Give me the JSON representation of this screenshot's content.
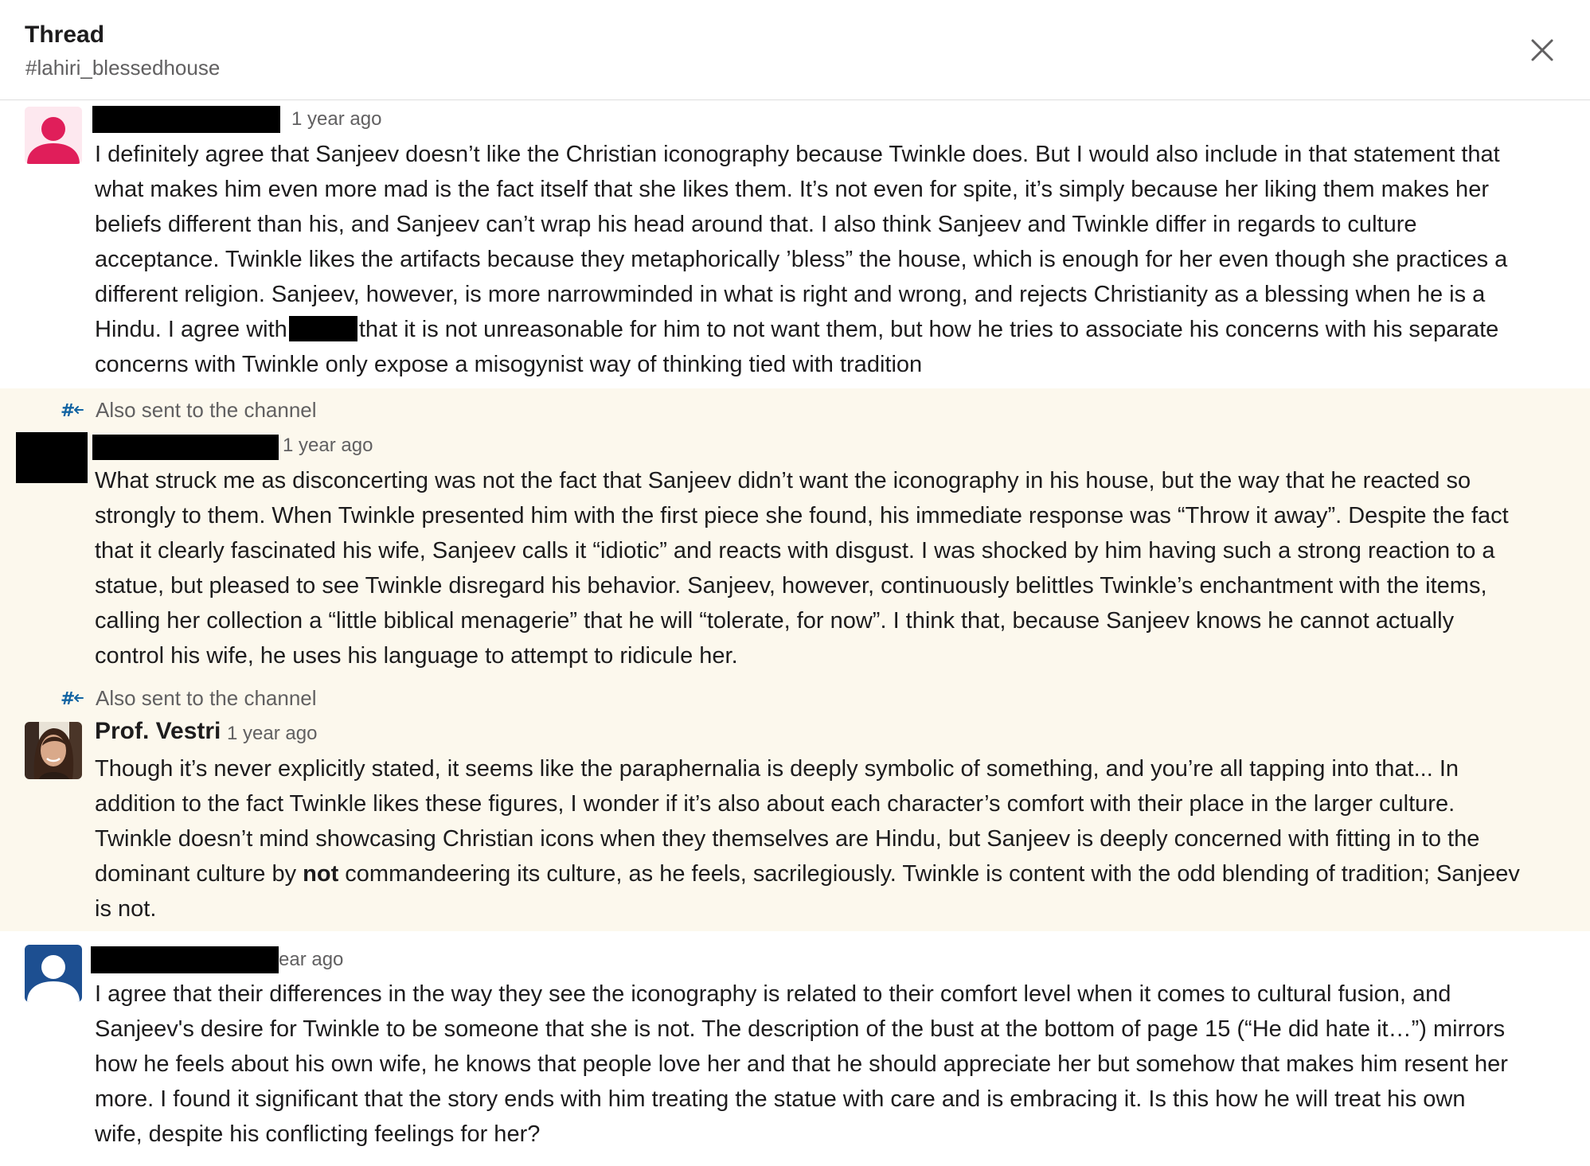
{
  "header": {
    "title": "Thread",
    "channel": "#lahiri_blessedhouse"
  },
  "messages": [
    {
      "time": "1 year ago",
      "author_redacted": true,
      "lines": [
        "I definitely agree that Sanjeev doesn’t like the Christian iconography because Twinkle does. But I would also include in that statement that",
        "what makes him even more mad is the fact itself that she likes them. It’s not even for spite, it’s simply because her liking them makes her",
        "beliefs different than his, and Sanjeev can’t wrap his head around that. I also think Sanjeev and Twinkle differ in regards to culture",
        "acceptance. Twinkle likes the artifacts because they metaphorically ’bless” the house, which is enough for her even though she practices a",
        "different religion. Sanjeev, however, is more narrowminded in what is right and wrong, and rejects Christianity as a blessing when he is a"
      ],
      "line6_before": "Hindu. I agree with",
      "line6_after": "that it is not unreasonable for him to not want them, but how he tries to associate his concerns with his separate",
      "line7": "concerns with Twinkle only expose a misogynist way of thinking tied with tradition"
    },
    {
      "also_sent": "Also sent to the channel",
      "time": "1 year ago",
      "author_redacted": true,
      "lines": [
        "What struck me as disconcerting was not the fact that Sanjeev didn’t want the iconography in his house, but the way that he reacted so",
        "strongly to them. When Twinkle presented him with the first piece she found, his immediate response was “Throw it away”. Despite the fact",
        "that it clearly fascinated his wife, Sanjeev calls it “idiotic” and reacts with disgust. I was shocked by him having such a strong reaction to a",
        "statue, but pleased to see Twinkle disregard his behavior. Sanjeev, however, continuously belittles Twinkle’s enchantment with the items,",
        "calling her collection a “little biblical menagerie” that he will “tolerate, for now”. I think that, because Sanjeev knows he cannot actually",
        "control his wife, he uses his language to attempt to ridicule her."
      ]
    },
    {
      "also_sent": "Also sent to the channel",
      "author": "Prof. Vestri",
      "time": "1 year ago",
      "lines": [
        "Though it’s never explicitly stated, it seems like the paraphernalia is deeply symbolic of something, and you’re all tapping into that... In",
        "addition to the fact Twinkle likes these figures, I wonder if it’s also about each character’s comfort with their place in the larger culture.",
        "Twinkle doesn’t mind showcasing Christian icons when they themselves are Hindu, but Sanjeev is deeply concerned with fitting in to the"
      ],
      "line4_before": "dominant culture by ",
      "line4_bold": "not",
      "line4_after": " commandeering its culture, as he feels, sacrilegiously. Twinkle is content with the odd blending of tradition; Sanjeev",
      "line5": "is not."
    },
    {
      "time": "ear ago",
      "author_redacted": true,
      "lines": [
        "I agree that their differences in the way they see the iconography is related to their comfort level when it comes to cultural fusion, and",
        "Sanjeev's desire for Twinkle to be someone that she is not. The description of the bust at the bottom of page 15 (“He did hate it…”) mirrors",
        "how he feels about his own wife, he knows that people love her and that he should appreciate her but somehow that makes him resent her",
        "more. I found it significant that the story ends with him treating the statue with care and is embracing it. Is this how he will treat his own",
        "wife, despite his conflicting feelings for her?"
      ]
    }
  ],
  "colors": {
    "highlight": "#fcf8ed",
    "avatar_pink": "#e01e5a",
    "avatar_blue": "#1d4f91",
    "hash_icon": "#1264a3"
  },
  "icons": {
    "close": "close-icon",
    "also_sent": "channel-hash-arrow-icon",
    "default_avatar": "user-silhouette-icon"
  }
}
